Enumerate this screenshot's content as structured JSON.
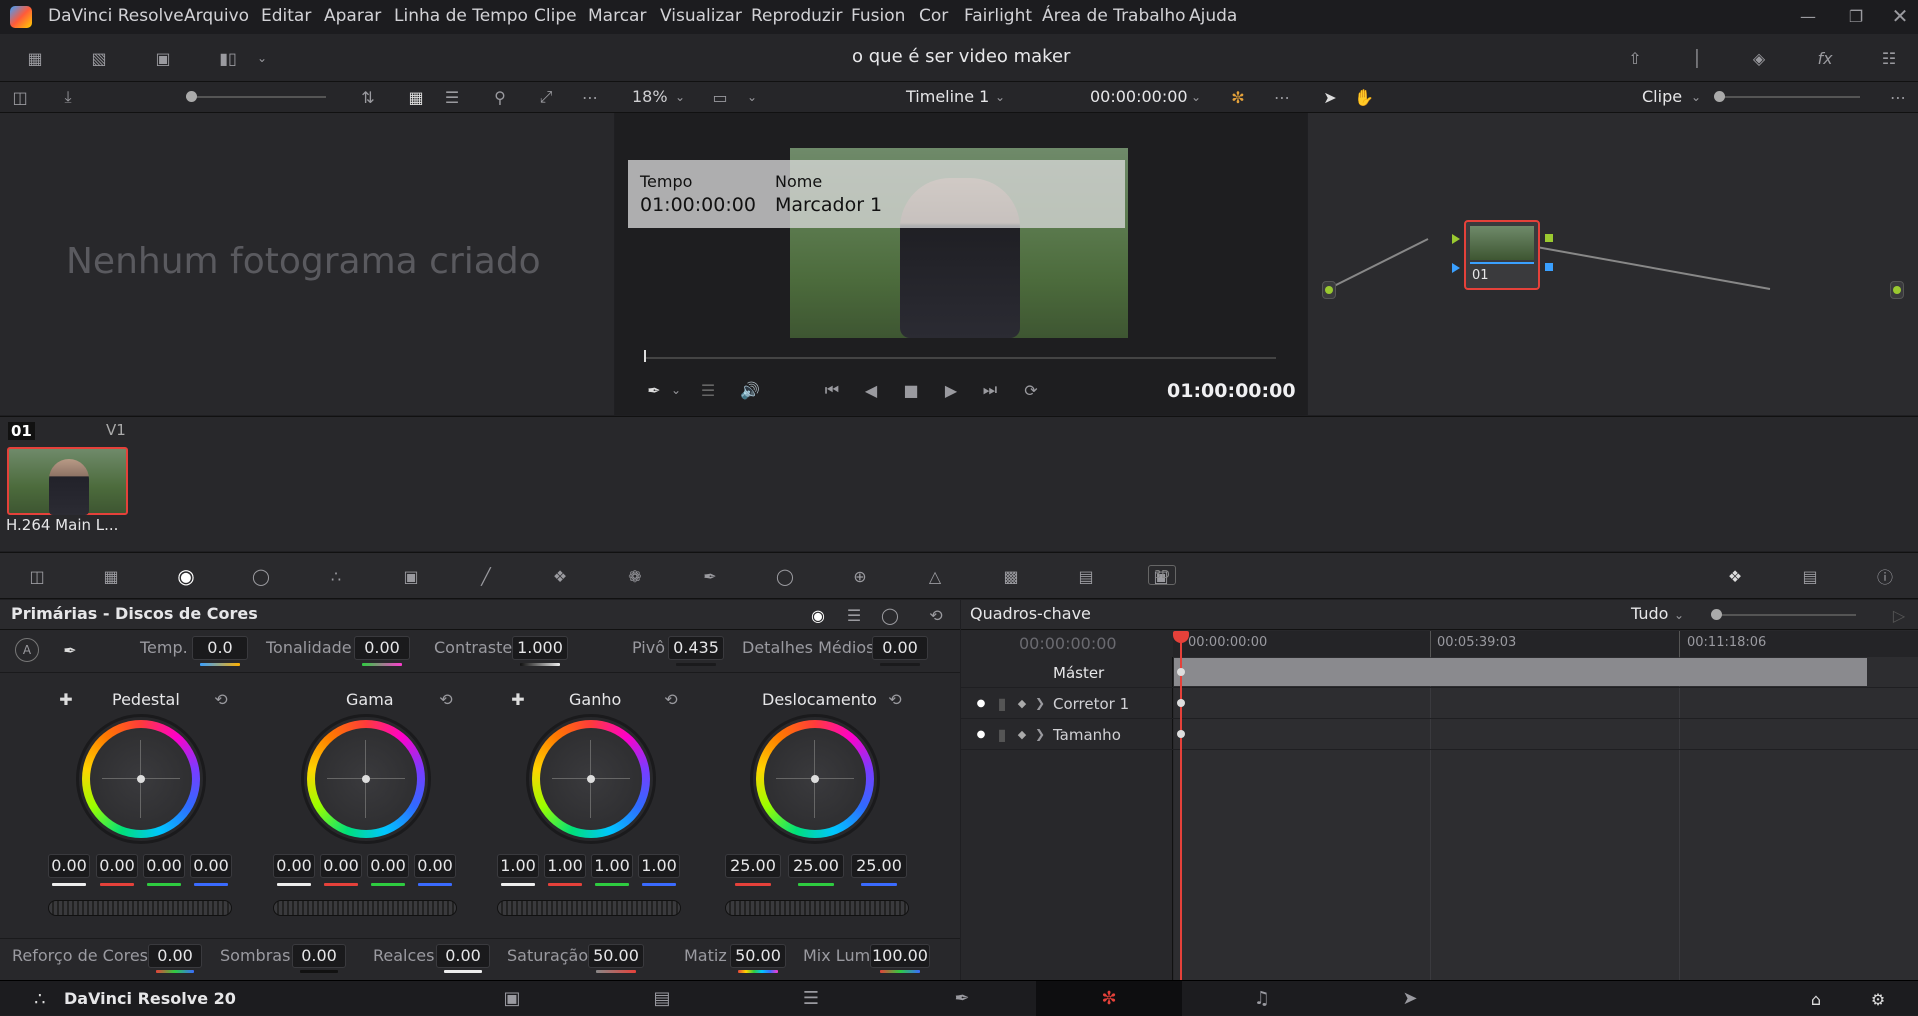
{
  "menubar": {
    "app_name": "DaVinci Resolve",
    "items": [
      "Arquivo",
      "Editar",
      "Aparar",
      "Linha de Tempo",
      "Clipe",
      "Marcar",
      "Visualizar",
      "Reproduzir",
      "Fusion",
      "Cor",
      "Fairlight",
      "Área de Trabalho",
      "Ajuda"
    ]
  },
  "project": {
    "title": "o que é ser video maker"
  },
  "viewer": {
    "zoom": "18%",
    "timeline_name": "Timeline 1",
    "timecode_top": "00:00:00:00",
    "marker_overlay": {
      "time_label": "Tempo",
      "time_value": "01:00:00:00",
      "name_label": "Nome",
      "name_value": "Marcador 1"
    },
    "timecode": "01:00:00:00"
  },
  "gallery": {
    "empty_text": "Nenhum fotograma criado"
  },
  "nodes": {
    "mode": "Clipe",
    "node_label": "01"
  },
  "clips": {
    "clip_number": "01",
    "track": "V1",
    "clip_name": "H.264 Main L..."
  },
  "primaries": {
    "title": "Primárias - Discos de Cores",
    "temp_label": "Temp.",
    "temp_value": "0.0",
    "tint_label": "Tonalidade",
    "tint_value": "0.00",
    "contrast_label": "Contraste",
    "contrast_value": "1.000",
    "pivot_label": "Pivô",
    "pivot_value": "0.435",
    "middetail_label": "Detalhes Médios",
    "middetail_value": "0.00",
    "wheels": [
      {
        "name": "Pedestal",
        "values": [
          "0.00",
          "0.00",
          "0.00",
          "0.00"
        ]
      },
      {
        "name": "Gama",
        "values": [
          "0.00",
          "0.00",
          "0.00",
          "0.00"
        ]
      },
      {
        "name": "Ganho",
        "values": [
          "1.00",
          "1.00",
          "1.00",
          "1.00"
        ]
      },
      {
        "name": "Deslocamento",
        "values": [
          "25.00",
          "25.00",
          "25.00"
        ]
      }
    ],
    "bottom": {
      "boost_label": "Reforço de Cores",
      "boost_value": "0.00",
      "shadows_label": "Sombras",
      "shadows_value": "0.00",
      "highlights_label": "Realces",
      "highlights_value": "0.00",
      "saturation_label": "Saturação",
      "saturation_value": "50.00",
      "hue_label": "Matiz",
      "hue_value": "50.00",
      "lummix_label": "Mix Lum",
      "lummix_value": "100.00"
    }
  },
  "keyframes": {
    "title": "Quadros-chave",
    "filter": "Tudo",
    "timecode": "00:00:00:00",
    "ruler": [
      "00:00:00:00",
      "00:05:39:03",
      "00:11:18:06"
    ],
    "tracks": [
      "Máster",
      "Corretor 1",
      "Tamanho"
    ]
  },
  "pagebar": {
    "brand": "DaVinci Resolve 20"
  },
  "colors": {
    "accent_red": "#e5413a",
    "active_page_bg": "#0e0e10"
  }
}
